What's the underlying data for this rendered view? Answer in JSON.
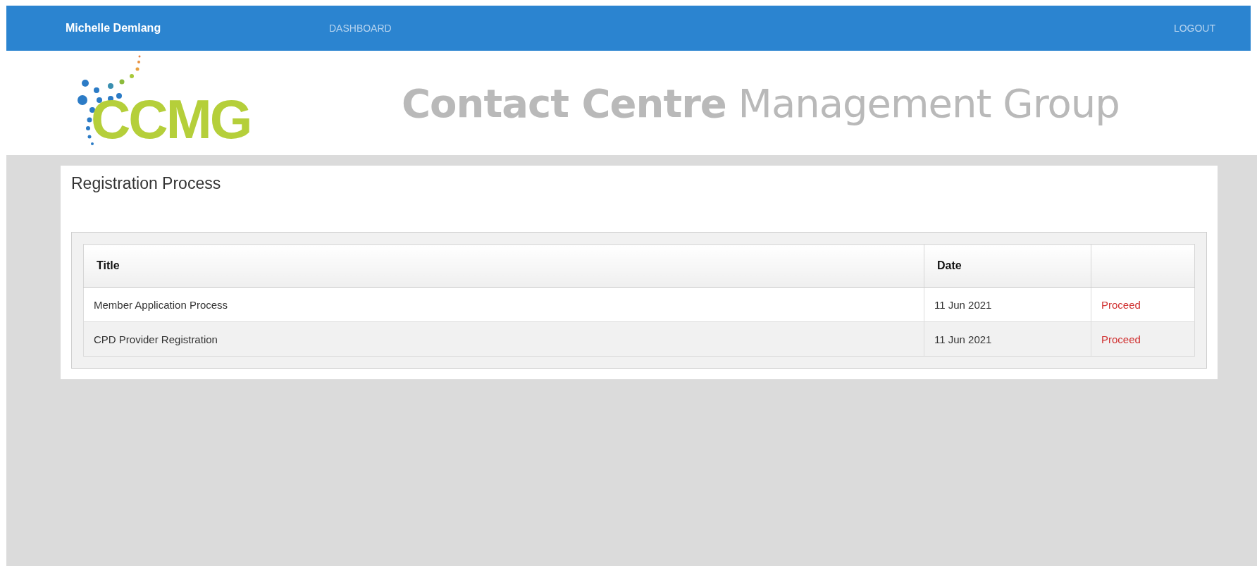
{
  "navbar": {
    "user_name": "Michelle Demlang",
    "links": [
      {
        "label": "DASHBOARD"
      }
    ],
    "logout": "LOGOUT"
  },
  "header": {
    "logo_text": "CCMG",
    "title": "**Contact Centre** Management Group"
  },
  "card": {
    "title": "Registration Process",
    "table": {
      "columns": [
        "Title",
        "Date",
        ""
      ],
      "rows": [
        {
          "title": "Member Application Process",
          "date": "11 Jun 2021",
          "action": "Proceed"
        },
        {
          "title": "CPD Provider Registration",
          "date": "11 Jun 2021",
          "action": "Proceed"
        }
      ]
    }
  }
}
